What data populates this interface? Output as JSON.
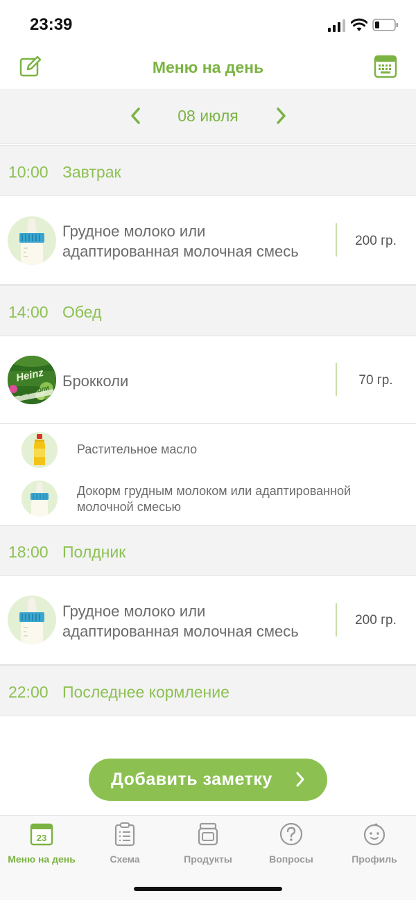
{
  "status": {
    "time": "23:39"
  },
  "header": {
    "title": "Меню на день",
    "edit_icon": "edit-icon",
    "keyboard_icon": "keyboard-icon"
  },
  "date": {
    "label": "08 июля",
    "prev_icon": "chevron-left-icon",
    "next_icon": "chevron-right-icon"
  },
  "meals": [
    {
      "time": "10:00",
      "title": "Завтрак"
    },
    {
      "time": "14:00",
      "title": "Обед"
    },
    {
      "time": "18:00",
      "title": "Полдник"
    },
    {
      "time": "22:00",
      "title": "Последнее кормление"
    }
  ],
  "items": [
    {
      "name_line1": "Грудное молоко или",
      "name_line2": "адаптированная молочная смесь",
      "qty": "200 гр.",
      "icon": "baby-bottle-icon"
    },
    {
      "name_line1": "Брокколи",
      "qty": "70 гр.",
      "icon": "broccoli-jar-icon",
      "brand": "Heinz",
      "jar_text": "БРОККОЛИ"
    },
    {
      "name_line1": "Грудное молоко или",
      "name_line2": "адаптированная молочная смесь",
      "qty": "200 гр.",
      "icon": "baby-bottle-icon"
    }
  ],
  "subitems": [
    {
      "name_line1": "Растительное масло",
      "icon": "oil-bottle-icon"
    },
    {
      "name_line1": "Докорм грудным молоком или адаптированной",
      "name_line2": "молочной смесью",
      "icon": "baby-bottle-icon"
    }
  ],
  "add_button": {
    "label": "Добавить заметку"
  },
  "tabs": [
    {
      "label": "Меню на день",
      "icon": "calendar-icon",
      "badge": "23",
      "active": true
    },
    {
      "label": "Схема",
      "icon": "clipboard-icon"
    },
    {
      "label": "Продукты",
      "icon": "jar-icon"
    },
    {
      "label": "Вопросы",
      "icon": "question-icon"
    },
    {
      "label": "Профиль",
      "icon": "baby-face-icon"
    }
  ],
  "colors": {
    "accent": "#7bb342",
    "accent_light": "#8cc152",
    "section_bg": "#f3f3f3"
  }
}
